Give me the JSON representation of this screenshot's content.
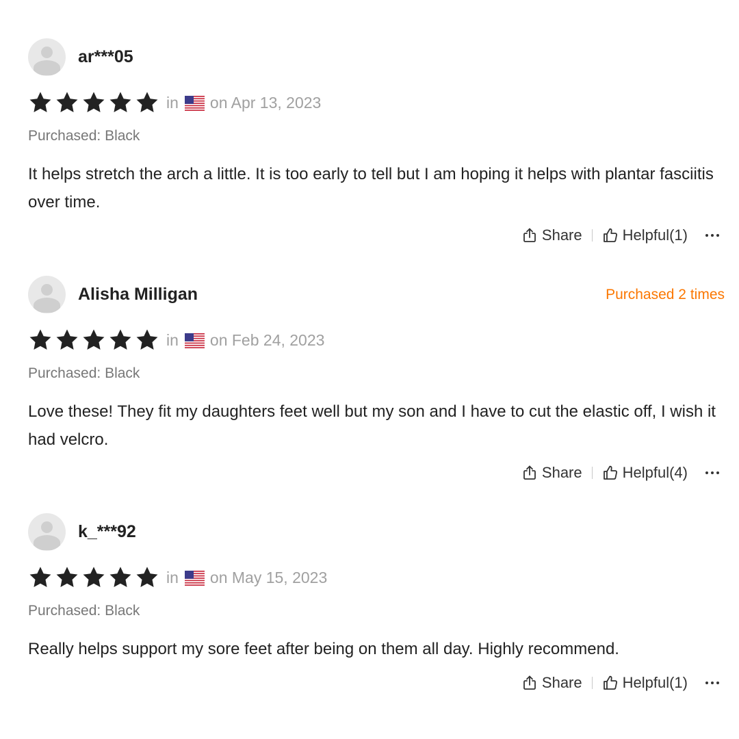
{
  "reviews": [
    {
      "author": "ar***05",
      "purchased_times": "",
      "rating": 5,
      "in_label": "in",
      "country_icon": "us-flag-icon",
      "date": "on Apr 13, 2023",
      "variant": "Purchased: Black",
      "text": "It helps stretch the arch a little. It is too early to tell but I am hoping it helps with plantar fasciitis over time.",
      "share_label": "Share",
      "helpful_label": "Helpful(1)"
    },
    {
      "author": "Alisha Milligan",
      "purchased_times": "Purchased 2 times",
      "rating": 5,
      "in_label": "in",
      "country_icon": "us-flag-icon",
      "date": "on Feb 24, 2023",
      "variant": "Purchased: Black",
      "text": "Love these! They fit my daughters feet well but my son and I have to cut the elastic off, I wish it had velcro.",
      "share_label": "Share",
      "helpful_label": "Helpful(4)"
    },
    {
      "author": "k_***92",
      "purchased_times": "",
      "rating": 5,
      "in_label": "in",
      "country_icon": "us-flag-icon",
      "date": "on May 15, 2023",
      "variant": "Purchased: Black",
      "text": "Really helps support my sore feet after being on them all day. Highly recommend.",
      "share_label": "Share",
      "helpful_label": "Helpful(1)"
    }
  ],
  "icons": {
    "star": "star-icon",
    "share": "share-icon",
    "helpful": "thumbs-up-icon",
    "more": "more-options-icon",
    "avatar": "avatar-placeholder-icon"
  },
  "colors": {
    "star": "#222222",
    "meta": "#a0a0a0",
    "purchased_times": "#fb7701",
    "text": "#222222"
  }
}
